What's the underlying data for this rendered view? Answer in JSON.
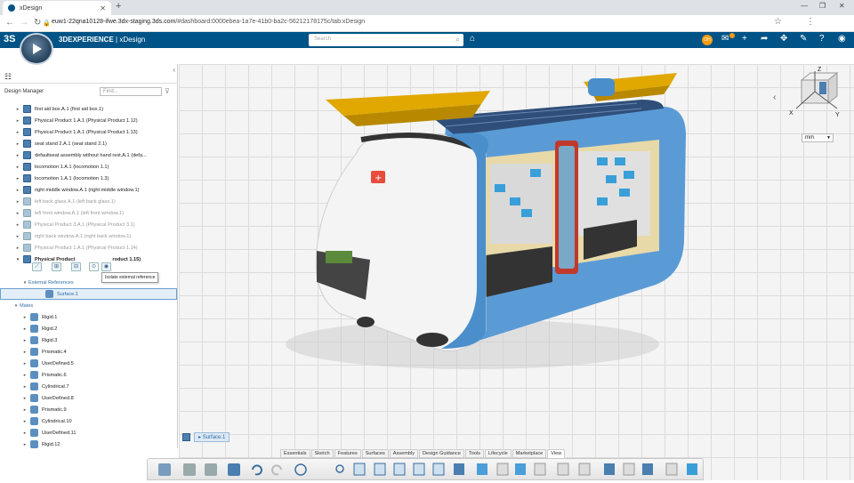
{
  "browser": {
    "tab_title": "xDesign",
    "url_host": "euw1-22qna10128-ifwe.3dx-staging.3ds.com",
    "url_rest": "/#dashboard:0000ebea-1a7e-41b0-ba2c-56212178175c/tab:xDesign"
  },
  "app": {
    "brand": "3DEXPERIENCE",
    "app_name": " | xDesign",
    "search_placeholder": "Search",
    "avatar_initials": "OH"
  },
  "panel": {
    "title": "Design Manager",
    "find_placeholder": "Find...",
    "tooltip": "Isolate external reference"
  },
  "tree": [
    {
      "label": "first aid box.A.1 (first aid box.1)",
      "dim": false
    },
    {
      "label": "Physical Product 1.A.1 (Physical Product 1.12)",
      "dim": false
    },
    {
      "label": "Physical Product 1.A.1 (Physical Product 1.13)",
      "dim": false
    },
    {
      "label": "seat stand 2.A.1 (seat stand 2.1)",
      "dim": false
    },
    {
      "label": "defaultseat assembly without hand rest.A.1 (defa...",
      "dim": false
    },
    {
      "label": "locomotion 1.A.1 (locomotion 1.1)",
      "dim": false
    },
    {
      "label": "locomotion 1.A.1 (locomotion 1.3)",
      "dim": false
    },
    {
      "label": "right middle window.A.1 (right middle window.1)",
      "dim": false
    },
    {
      "label": "left back glass.A.1 (left back glass.1)",
      "dim": true
    },
    {
      "label": "left front window.A.1 (left front window.1)",
      "dim": true
    },
    {
      "label": "Physical Product 3.A.1 (Physical Product 3.1)",
      "dim": true
    },
    {
      "label": "right back window.A.1 (right back window.1)",
      "dim": true
    },
    {
      "label": "Physical Product 1.A.1 (Physical Product 1.14)",
      "dim": true
    }
  ],
  "selected_product": {
    "label_a": "Physical Product",
    "label_b": "roduct 1.15)"
  },
  "external_refs": {
    "label": "External References",
    "child": "Surface.1"
  },
  "mates": {
    "label": "Mates",
    "items": [
      "Rigid.1",
      "Rigid.2",
      "Rigid.3",
      "Prismatic.4",
      "UserDefined.5",
      "Prismatic.6",
      "Cylindrical.7",
      "UserDefined.8",
      "Prismatic.9",
      "Cylindrical.10",
      "UserDefined.11",
      "Rigid.12"
    ]
  },
  "viewport": {
    "unit": "mm",
    "axis_x": "X",
    "axis_y": "Y",
    "axis_z": "Z",
    "breadcrumb": "Surface.1"
  },
  "action_tabs": [
    "Essentials",
    "Sketch",
    "Features",
    "Surfaces",
    "Assembly",
    "Design Guidance",
    "Tools",
    "Lifecycle",
    "Marketplace",
    "View"
  ],
  "active_tab": "View",
  "colors": {
    "app_bar": "#005386",
    "bus_blue": "#5b9bd5",
    "bus_white": "#f2f2f2",
    "solar_yellow": "#e0a800",
    "accent_red": "#c0392b"
  }
}
